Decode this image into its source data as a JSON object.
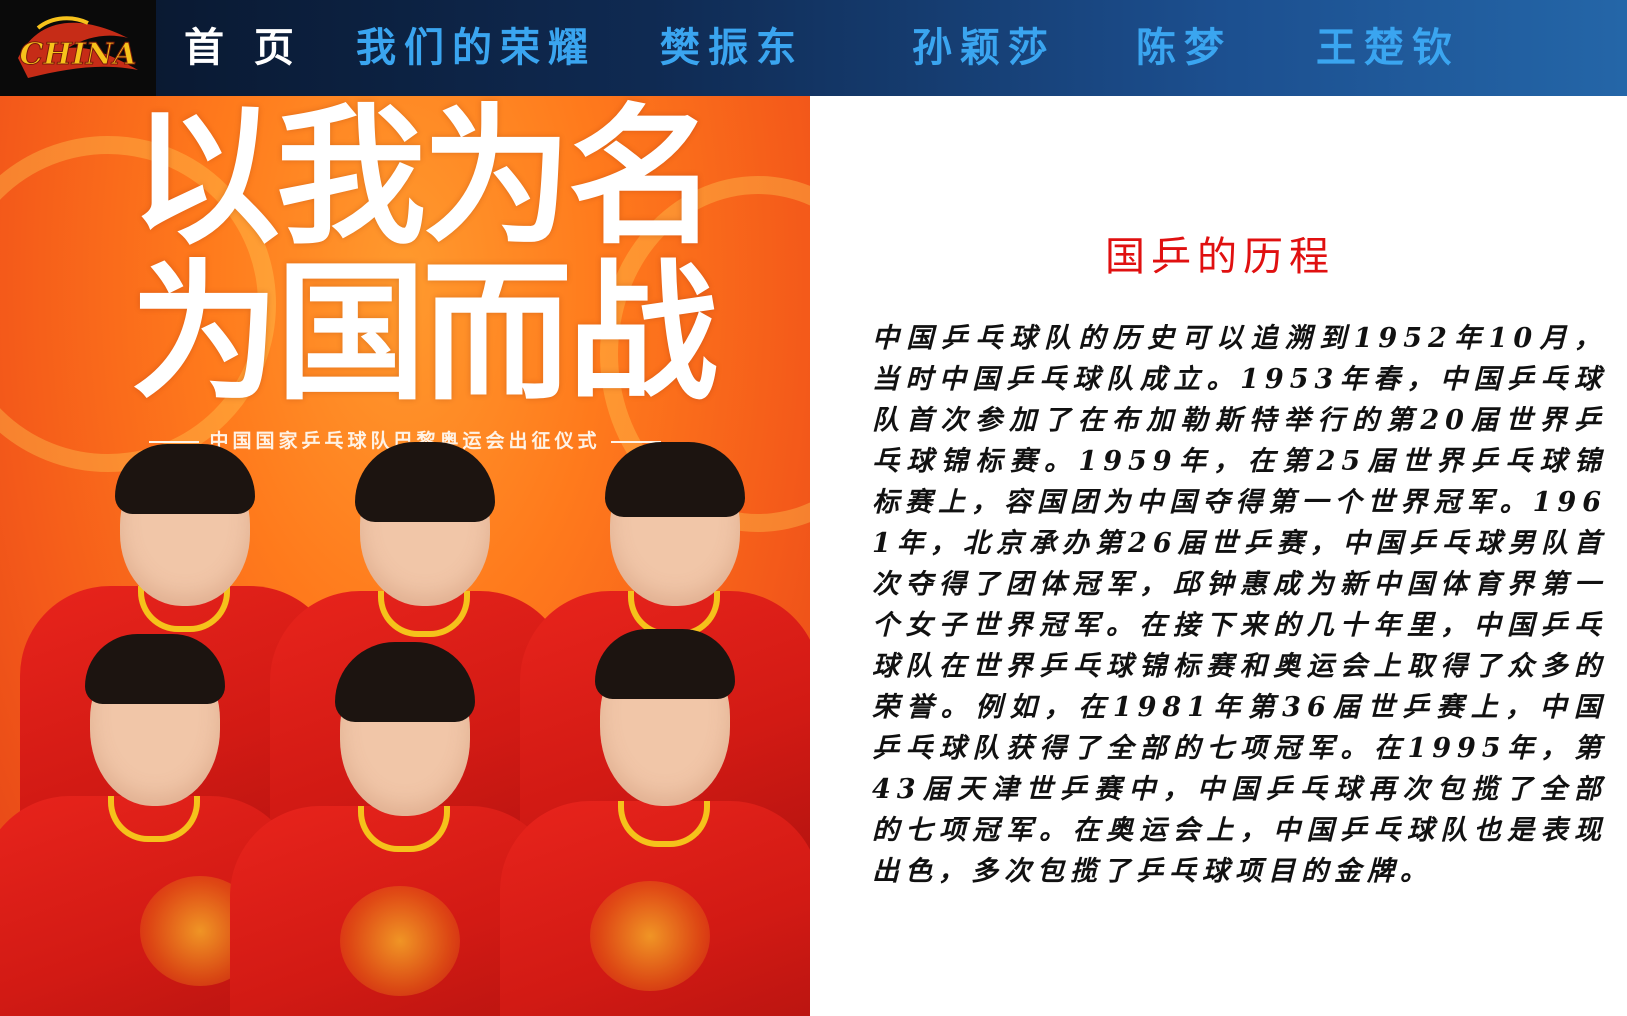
{
  "nav": {
    "logo_text": "CHINA",
    "items": [
      {
        "label": "首 页"
      },
      {
        "label": "我们的荣耀"
      },
      {
        "label": "樊振东"
      },
      {
        "label": "孙颖莎"
      },
      {
        "label": "陈梦"
      },
      {
        "label": "王楚钦"
      }
    ]
  },
  "poster": {
    "title_line1": "以我为名",
    "title_line2": "为国而战",
    "subtitle": "中国国家乒乓球队巴黎奥运会出征仪式"
  },
  "content": {
    "title": "国乒的历程",
    "body": "中国乒乓球队的历史可以追溯到1952年10月，当时中国乒乓球队成立。1953年春，中国乒乓球队首次参加了在布加勒斯特举行的第20届世界乒乓球锦标赛。1959年，在第25届世界乒乓球锦标赛上，容国团为中国夺得第一个世界冠军。1961年，北京承办第26届世乒赛，中国乒乓球男队首次夺得了团体冠军，邱钟惠成为新中国体育界第一个女子世界冠军。在接下来的几十年里，中国乒乓球队在世界乒乓球锦标赛和奥运会上取得了众多的荣誉。例如，在1981年第36届世乒赛上，中国乒乓球队获得了全部的七项冠军。在1995年，第43届天津世乒赛中，中国乒乓球再次包揽了全部的七项冠军。在奥运会上，中国乒乓球队也是表现出色，多次包揽了乒乓球项目的金牌。"
  },
  "colors": {
    "nav_active": "#ffffff",
    "nav_link": "#3aa5f0",
    "title_red": "#e01010",
    "poster_orange": "#ff7a1c"
  }
}
